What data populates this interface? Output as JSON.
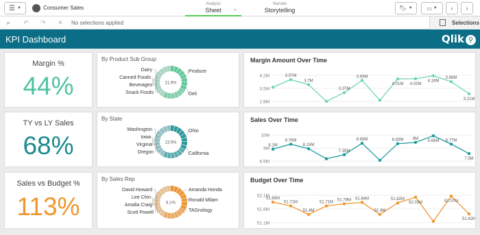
{
  "topbar": {
    "app_name": "Consumer Sales",
    "analyze_label": "Analyze",
    "sheet_label": "Sheet",
    "narrate_label": "Narrate",
    "storytelling_label": "Storytelling"
  },
  "selection_bar": {
    "no_selections": "No selections applied",
    "selections_label": "Selections"
  },
  "dashboard": {
    "title": "KPI Dashboard",
    "logo_text": "Qlik"
  },
  "kpis": [
    {
      "label": "Margin %",
      "value": "44%",
      "color": "#4fc3a1"
    },
    {
      "label": "TY vs LY Sales",
      "value": "68%",
      "color": "#1a8a8e"
    },
    {
      "label": "Sales vs Budget %",
      "value": "113%",
      "color": "#f0962e"
    }
  ],
  "donuts": [
    {
      "title": "By Product Sub Group",
      "center": "21.6%",
      "color": "#5fc99a",
      "left_labels": [
        "Dairy",
        "Canned Foods",
        "Beverages",
        "Snack Foods"
      ],
      "right_labels": [
        "Produce",
        "Deli"
      ]
    },
    {
      "title": "By State",
      "center": "13.5%",
      "color": "#2a9a9e",
      "left_labels": [
        "Washington",
        "Iowa",
        "Virginia",
        "Oregon"
      ],
      "right_labels": [
        "Ohio",
        "California"
      ]
    },
    {
      "title": "By Sales Rep",
      "center": "8.1%",
      "color": "#f0962e",
      "left_labels": [
        "David Howard",
        "Lee Chin",
        "Amalia Craig",
        "Scott Powell"
      ],
      "right_labels": [
        "Amanda Honda",
        "Ronald Milam",
        "TAGnology"
      ]
    }
  ],
  "chart_data": [
    {
      "type": "line",
      "title": "Margin Amount Over Time",
      "color": "#6fd4b4",
      "y_ticks": [
        "4.2M",
        "3.5M",
        "2.8M"
      ],
      "ylim": [
        2.8,
        4.2
      ],
      "values": [
        3.56,
        3.97,
        3.7,
        2.8,
        3.27,
        3.93,
        2.86,
        4.01,
        4.02,
        4.18,
        3.86,
        3.21
      ],
      "data_labels": [
        "",
        "3.97M",
        "3.7M",
        "",
        "3.27M",
        "3.93M",
        "",
        "4.01M",
        "4.02M",
        "4.18M",
        "3.86M",
        "3.21M"
      ]
    },
    {
      "type": "line",
      "title": "Sales Over Time",
      "color": "#1a9b9b",
      "y_ticks": [
        "10M",
        "9M",
        "6.5M"
      ],
      "ylim": [
        6.5,
        10
      ],
      "values": [
        8.1,
        8.76,
        8.15,
        6.8,
        7.35,
        8.89,
        6.6,
        8.83,
        9.0,
        9.89,
        8.77,
        7.5
      ],
      "data_labels": [
        "8.1M",
        "8.76M",
        "8.15M",
        "",
        "7.35M",
        "8.89M",
        "",
        "8.83M",
        "9M",
        "9.89M",
        "8.77M",
        "7.5M"
      ]
    },
    {
      "type": "line",
      "title": "Budget Over Time",
      "color": "#f0962e",
      "y_ticks": [
        "52.1M",
        "51.6M",
        "51.1M"
      ],
      "ylim": [
        51.1,
        52.1
      ],
      "values": [
        51.85,
        51.71,
        51.4,
        51.71,
        51.79,
        51.84,
        51.4,
        51.82,
        52.03,
        51.15,
        52.07,
        51.42
      ],
      "data_labels": [
        "51.85M",
        "51.71M",
        "51.4M",
        "51.71M",
        "51.79M",
        "51.84M",
        "51.4M",
        "51.82M",
        "52.03M",
        "",
        "52.07M",
        "51.42M"
      ]
    }
  ]
}
